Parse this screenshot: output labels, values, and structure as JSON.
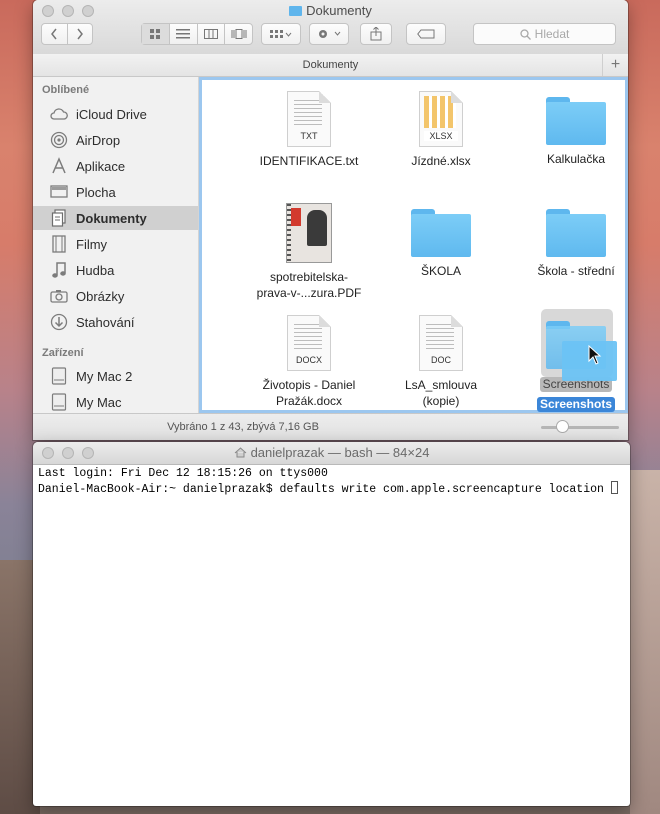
{
  "finder": {
    "title": "Dokumenty",
    "search_placeholder": "Hledat",
    "pathbar_label": "Dokumenty",
    "sidebar": {
      "favorites_header": "Oblíbené",
      "items": [
        {
          "label": "iCloud Drive",
          "icon": "cloud-icon"
        },
        {
          "label": "AirDrop",
          "icon": "airdrop-icon"
        },
        {
          "label": "Aplikace",
          "icon": "applications-icon"
        },
        {
          "label": "Plocha",
          "icon": "desktop-icon"
        },
        {
          "label": "Dokumenty",
          "icon": "documents-icon",
          "selected": true
        },
        {
          "label": "Filmy",
          "icon": "movies-icon"
        },
        {
          "label": "Hudba",
          "icon": "music-icon"
        },
        {
          "label": "Obrázky",
          "icon": "camera-icon"
        },
        {
          "label": "Stahování",
          "icon": "downloads-icon"
        }
      ],
      "devices_header": "Zařízení",
      "devices": [
        {
          "label": "My Mac 2",
          "icon": "hard-drive-icon"
        },
        {
          "label": "My Mac",
          "icon": "hard-drive-icon"
        }
      ]
    },
    "files": [
      {
        "name": "IDENTIFIKACE.txt",
        "kind": "doc",
        "tag": "TXT"
      },
      {
        "name": "Jízdné.xlsx",
        "kind": "xlsx",
        "tag": "XLSX"
      },
      {
        "name": "Kalkulačka",
        "kind": "folder"
      },
      {
        "name_line1": "spotrebitelska-",
        "name_line2": "prava-v-...zura.PDF",
        "kind": "pdf"
      },
      {
        "name": "ŠKOLA",
        "kind": "folder"
      },
      {
        "name": "Škola - střední",
        "kind": "folder"
      },
      {
        "name_line1": "Životopis - Daniel",
        "name_line2": "Pražák.docx",
        "kind": "doc",
        "tag": "DOCX"
      },
      {
        "name_line1": "LsA_smlouva",
        "name_line2": "(kopie)",
        "kind": "doc",
        "tag": "DOC"
      },
      {
        "name": "Screenshots",
        "ghost_label": "Screenshots",
        "kind": "folder",
        "selected": true
      }
    ],
    "status_text": "Vybráno 1 z 43, zbývá 7,16 GB",
    "icon_size_fraction": 0.27
  },
  "terminal": {
    "title": "danielprazak — bash — 84×24",
    "lines": [
      "Last login: Fri Dec 12 18:15:26 on ttys000",
      "Daniel-MacBook-Air:~ danielprazak$ defaults write com.apple.screencapture location "
    ]
  },
  "colors": {
    "selection": "#3b86d8",
    "folder": "#5fb9ef",
    "focus_ring": "#9cc7ef"
  }
}
